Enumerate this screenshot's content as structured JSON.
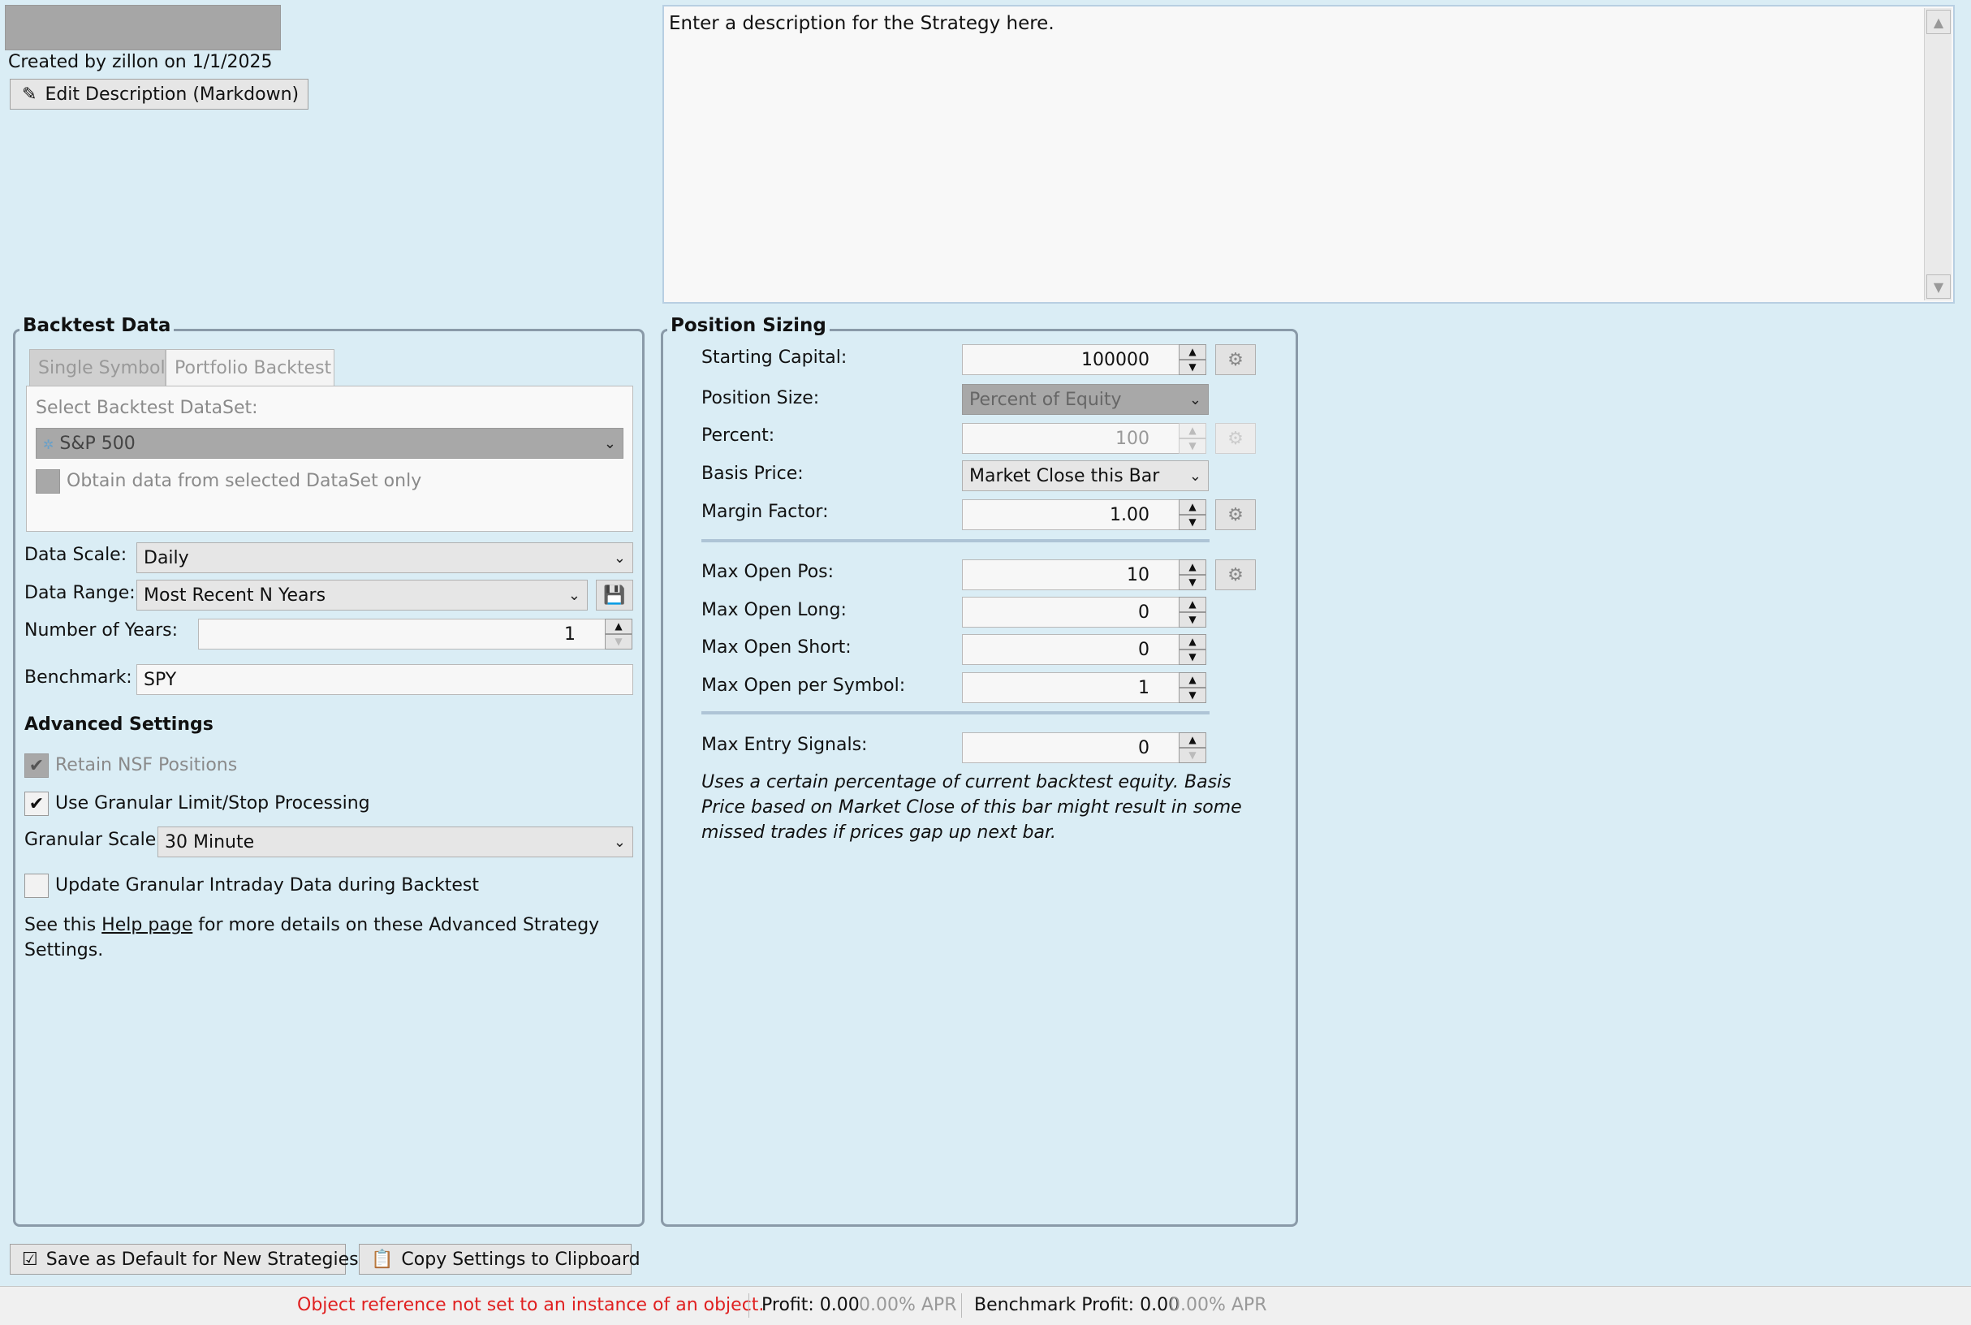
{
  "header": {
    "created_text": "Created by zillon on 1/1/2025",
    "edit_description_label": "Edit Description (Markdown)",
    "description": "Enter a description for the Strategy here."
  },
  "backtest": {
    "title": "Backtest Data",
    "tabs": [
      "Single Symbol",
      "Portfolio Backtest"
    ],
    "dataset_label": "Select Backtest DataSet:",
    "dataset_value": "S&P 500",
    "obtain_label": "Obtain data from selected DataSet only",
    "scale_label": "Data Scale:",
    "scale_value": "Daily",
    "range_label": "Data Range:",
    "range_value": "Most Recent N Years",
    "years_label": "Number of Years:",
    "years_value": "1",
    "benchmark_label": "Benchmark:",
    "benchmark_value": "SPY"
  },
  "advanced": {
    "title": "Advanced Settings",
    "retain_label": "Retain NSF Positions",
    "granular_label": "Use Granular Limit/Stop Processing",
    "granular_scale_label": "Granular Scale",
    "granular_scale_value": "30 Minute",
    "update_label": "Update Granular Intraday Data during Backtest",
    "help_prefix": "See this ",
    "help_link": "Help page",
    "help_suffix": " for more details on these Advanced Strategy",
    "help_suffix2": "Settings."
  },
  "sizing": {
    "title": "Position Sizing",
    "starting_capital_label": "Starting Capital:",
    "starting_capital_value": "100000",
    "position_size_label": "Position Size:",
    "position_size_value": "Percent of Equity",
    "percent_label": "Percent:",
    "percent_value": "100",
    "basis_label": "Basis Price:",
    "basis_value": "Market Close this Bar",
    "margin_label": "Margin Factor:",
    "margin_value": "1.00",
    "max_open_pos_label": "Max Open Pos:",
    "max_open_pos_value": "10",
    "max_open_long_label": "Max Open Long:",
    "max_open_long_value": "0",
    "max_open_short_label": "Max Open Short:",
    "max_open_short_value": "0",
    "max_per_symbol_label": "Max Open per Symbol:",
    "max_per_symbol_value": "1",
    "max_entry_label": "Max Entry Signals:",
    "max_entry_value": "0",
    "note_line1": "Uses a certain percentage of current backtest equity. Basis",
    "note_line2": "Price based on Market Close of this bar might result in some",
    "note_line3": "missed trades if prices gap up next bar."
  },
  "footer": {
    "save_default_label": "Save as Default for New Strategies",
    "copy_settings_label": "Copy Settings to Clipboard"
  },
  "status": {
    "error": "Object reference not set to an instance of an object.",
    "profit_label": "Profit: 0.00",
    "profit_apr": "0.00% APR",
    "bench_label": "Benchmark Profit: 0.00",
    "bench_apr": "0.00% APR"
  },
  "colors": {
    "error": "#e02020",
    "background": "#daedf5",
    "group_border": "#8a9aa8"
  }
}
